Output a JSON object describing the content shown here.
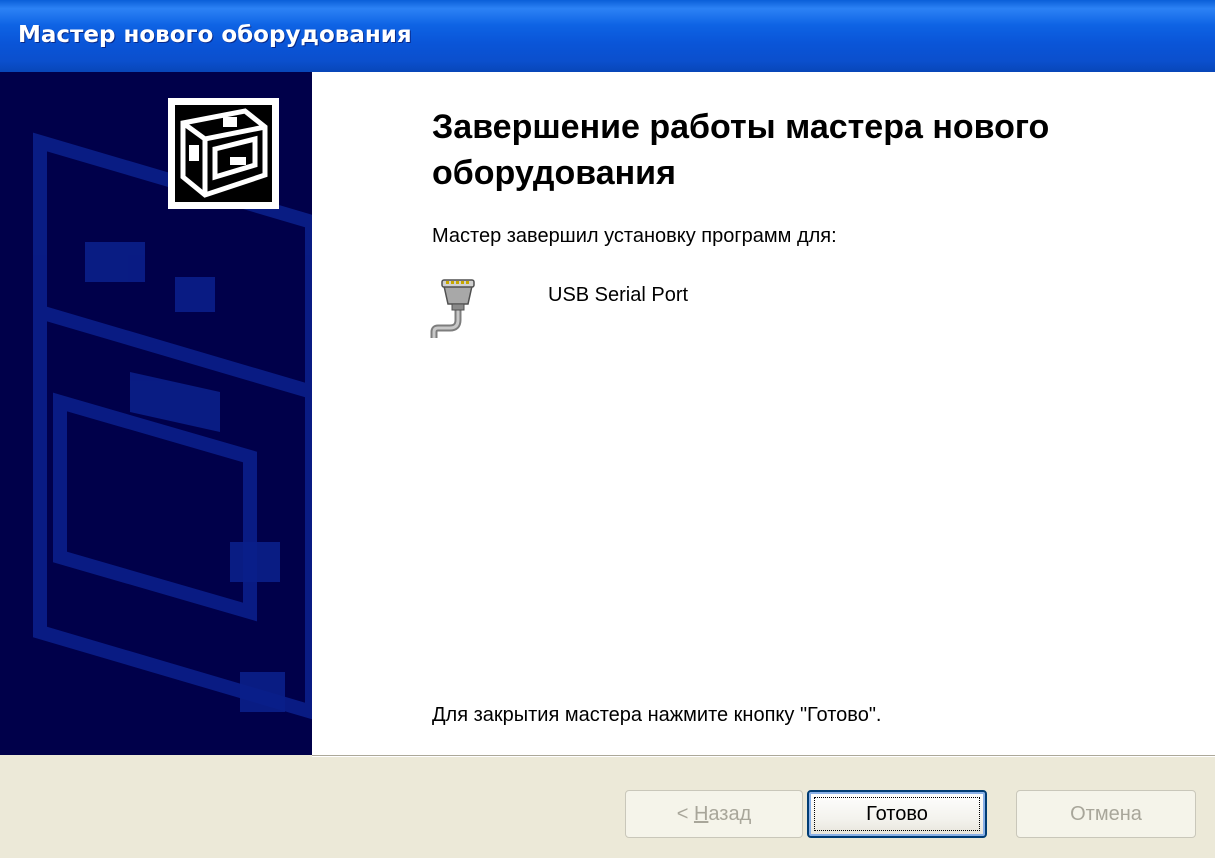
{
  "window": {
    "title": "Мастер нового оборудования"
  },
  "wizard": {
    "heading": "Завершение работы мастера нового оборудования",
    "subtitle": "Мастер завершил установку программ для:",
    "device_name": "USB Serial Port",
    "device_icon": "serial-port-icon",
    "wizard_icon": "hardware-icon",
    "footer_text": "Для закрытия мастера нажмите кнопку \"Готово\"."
  },
  "buttons": {
    "back_prefix": "< ",
    "back_mnemonic": "Н",
    "back_rest": "азад",
    "finish_label": "Готово",
    "cancel_label": "Отмена",
    "back_enabled": false,
    "finish_enabled": true,
    "cancel_enabled": false
  },
  "colors": {
    "titlebar": "#0a55d8",
    "sidebar": "#00004a",
    "dialog_face": "#ece9d8"
  }
}
